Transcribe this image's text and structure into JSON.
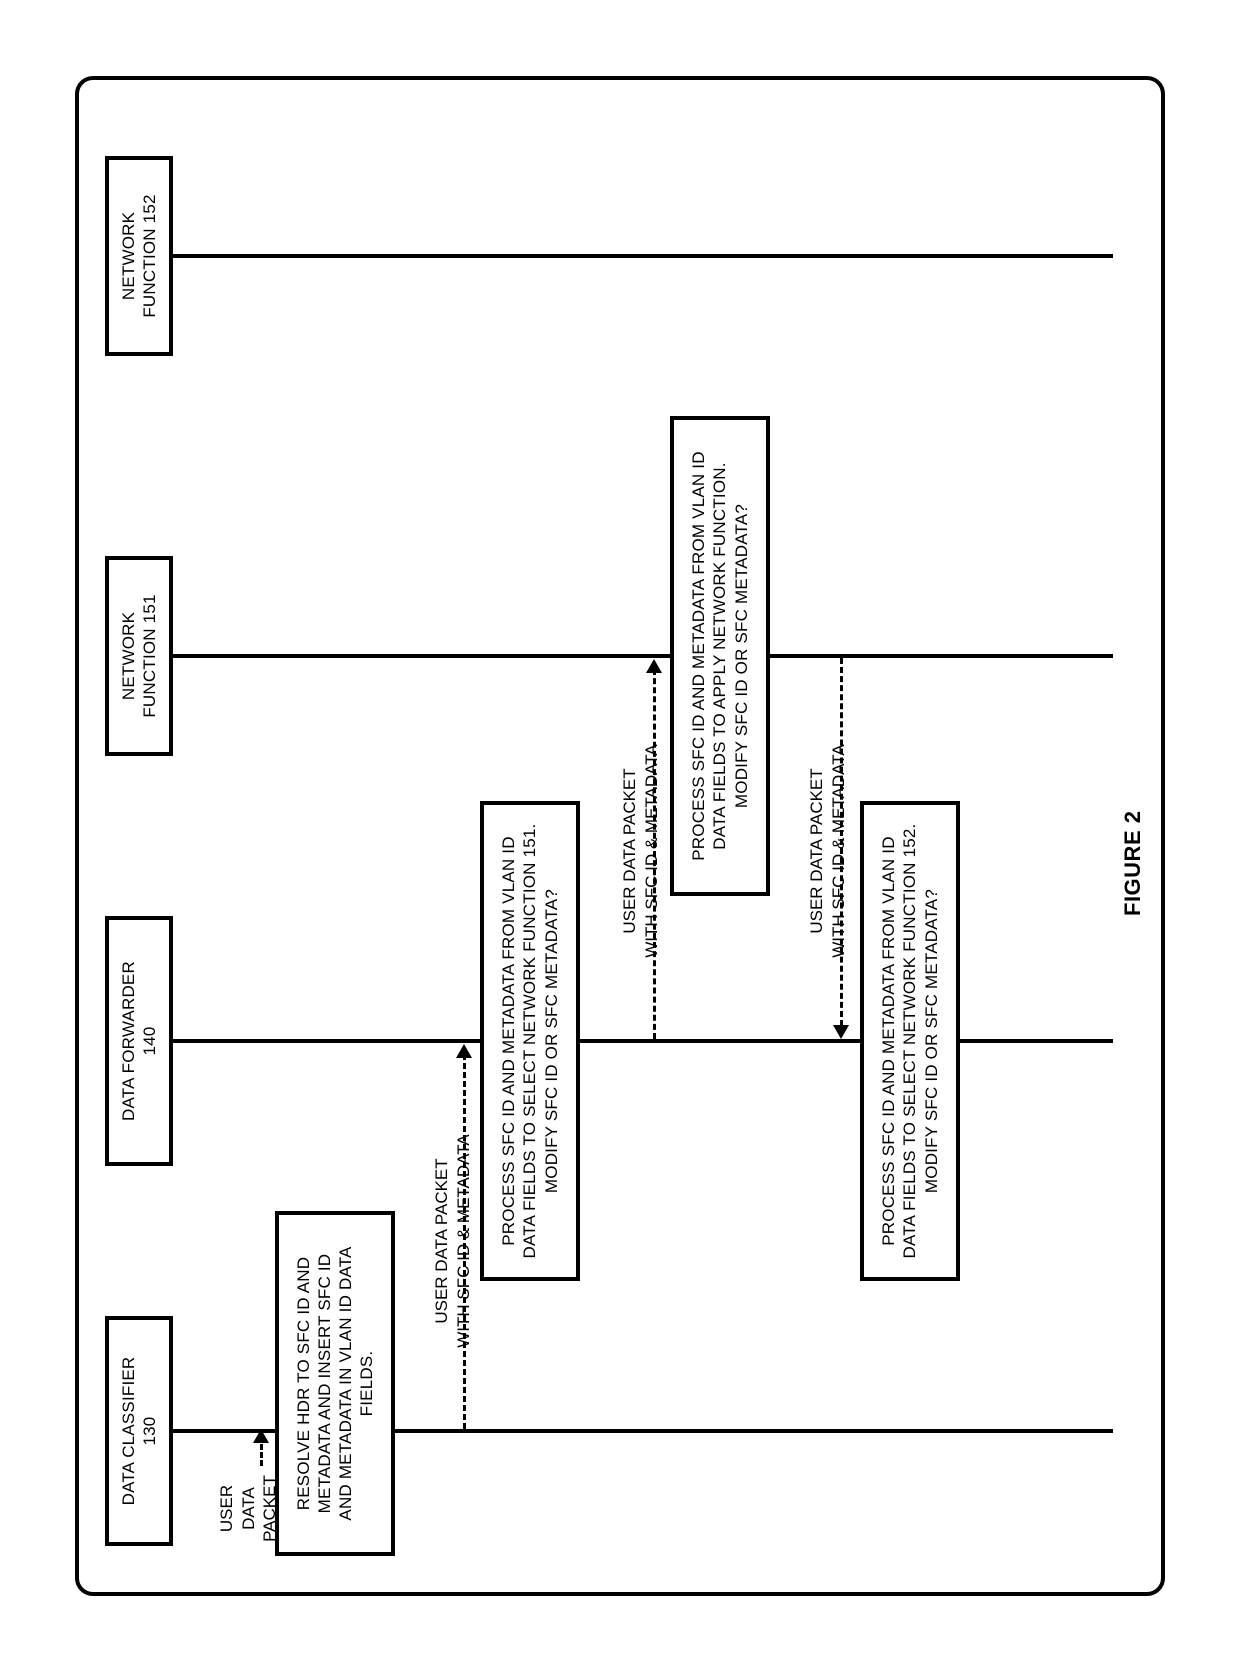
{
  "actors": {
    "classifier": "DATA CLASSIFIER\n130",
    "forwarder": "DATA FORWARDER\n140",
    "nf1": "NETWORK\nFUNCTION 151",
    "nf2": "NETWORK\nFUNCTION 152"
  },
  "packet_in": "USER\nDATA\nPACKET",
  "steps": {
    "resolve": "RESOLVE HDR TO SFC ID AND\nMETADATA AND INSERT SFC ID\nAND METADATA IN VLAN ID DATA\nFIELDS.",
    "sel151": "PROCESS SFC ID AND METADATA FROM VLAN ID\nDATA FIELDS TO SELECT NETWORK FUNCTION 151.\nMODIFY SFC ID OR SFC METADATA?",
    "apply": "PROCESS SFC ID AND METADATA FROM VLAN ID\nDATA FIELDS TO APPLY NETWORK FUNCTION.\nMODIFY SFC ID OR SFC METADATA?",
    "sel152": "PROCESS SFC ID AND METADATA FROM VLAN ID\nDATA FIELDS TO SELECT NETWORK FUNCTION 152.\nMODIFY SFC ID OR SFC METADATA?"
  },
  "messages": {
    "m1": "USER DATA PACKET\nWITH SFC ID & METADATA",
    "m2": "USER DATA PACKET\nWITH SFC ID & METADATA",
    "m3": "USER DATA PACKET\nWITH SFC ID & METADATA"
  },
  "figure": "FIGURE 2"
}
